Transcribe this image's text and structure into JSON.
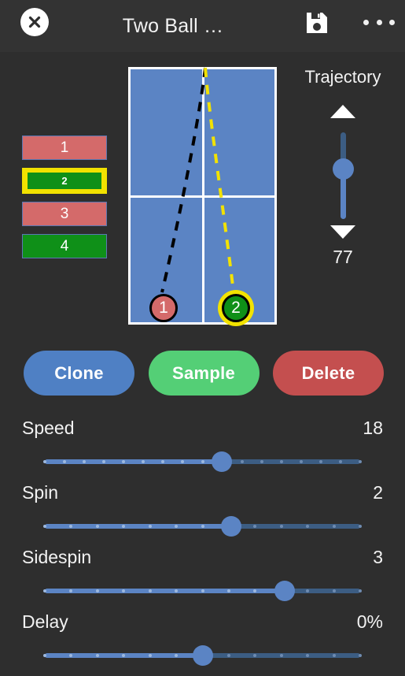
{
  "header": {
    "close_icon": "close-icon",
    "title": "Two Ball …",
    "save_icon": "save-icon",
    "menu_icon": "overflow-menu-icon"
  },
  "ball_list": {
    "items": [
      {
        "label": "1",
        "color": "#d46a6a",
        "selected": false
      },
      {
        "label": "2",
        "color": "#0f9018",
        "selected": true
      },
      {
        "label": "3",
        "color": "#d46a6a",
        "selected": false
      },
      {
        "label": "4",
        "color": "#0f9018",
        "selected": false
      }
    ]
  },
  "court": {
    "surface_color": "#5b84c4",
    "line_color": "#ffffff",
    "balls": [
      {
        "label": "1",
        "color": "#d46a6a",
        "selected": false
      },
      {
        "label": "2",
        "color": "#0f9018",
        "selected": true
      }
    ],
    "trajectories": [
      {
        "ball": "1",
        "color": "#000000",
        "style": "dashed"
      },
      {
        "ball": "2",
        "color": "#f2e200",
        "style": "dashed"
      }
    ]
  },
  "trajectory": {
    "label": "Trajectory",
    "up_icon": "arrow-up-icon",
    "down_icon": "arrow-down-icon",
    "value": "77",
    "thumb_pct": 50
  },
  "actions": {
    "clone": "Clone",
    "sample": "Sample",
    "delete": "Delete"
  },
  "sliders": [
    {
      "name": "Speed",
      "value": "18",
      "thumb_pct": 56,
      "ticks": 17
    },
    {
      "name": "Spin",
      "value": "2",
      "thumb_pct": 59,
      "ticks": 13
    },
    {
      "name": "Sidespin",
      "value": "3",
      "thumb_pct": 76,
      "ticks": 13
    },
    {
      "name": "Delay",
      "value": "0%",
      "thumb_pct": 50,
      "ticks": 13
    }
  ],
  "colors": {
    "background": "#2e2e2e",
    "header": "#333333",
    "accent_blue": "#5b84c4",
    "track_off": "#3c5d83",
    "red": "#d46a6a",
    "green": "#0f9018",
    "yellow": "#f2e200",
    "sample_green": "#54cf76",
    "delete_red": "#c44f4f"
  }
}
